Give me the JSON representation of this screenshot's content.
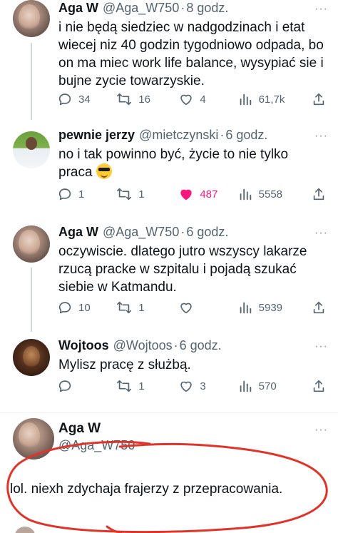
{
  "tweets": [
    {
      "name": "Aga W",
      "handle": "@Aga_W750",
      "dot": "·",
      "time": "8 godz.",
      "text": "i nie będą siedziec w nadgodzinach i etat wiecej niz 40 godzin tygodniowo odpada, bo on ma miec work life balance, wysypiać sie i bujne zycie towarzyskie.",
      "replies": "34",
      "retweets": "16",
      "likes": "4",
      "views": "61,7k",
      "more": "···"
    },
    {
      "name": "pewnie jerzy",
      "handle": "@mietczynski",
      "dot": "·",
      "time": "6 godz.",
      "text": "no i tak powinno być, życie to nie tylko praca",
      "replies": "1",
      "retweets": "1",
      "likes": "487",
      "views": "5558",
      "more": "···"
    },
    {
      "name": "Aga W",
      "handle": "@Aga_W750",
      "dot": "·",
      "time": "6 godz.",
      "text": "oczywiscie. dlatego jutro wszyscy lakarze rzucą pracke w szpitalu i pojadą szukać siebie w Katmandu.",
      "replies": "10",
      "retweets": "1",
      "likes": "",
      "views": "5939",
      "more": "···"
    },
    {
      "name": "Wojtoos",
      "handle": "@Wojtoos",
      "dot": "·",
      "time": "6 godz.",
      "text": "Mylisz pracę z służbą.",
      "replies": "",
      "retweets": "1",
      "likes": "3",
      "views": "570",
      "more": "···"
    }
  ],
  "focused": {
    "name": "Aga W",
    "handle": "@Aga_W750",
    "text": "lol. niexh zdychaja frajerzy z przepracowania.",
    "more": "···"
  },
  "colors": {
    "like_active": "#f91880",
    "annotation": "#e0342a",
    "secondary_text": "#536471"
  },
  "icons": [
    "reply-icon",
    "retweet-icon",
    "like-icon",
    "views-icon",
    "share-icon",
    "more-icon"
  ]
}
